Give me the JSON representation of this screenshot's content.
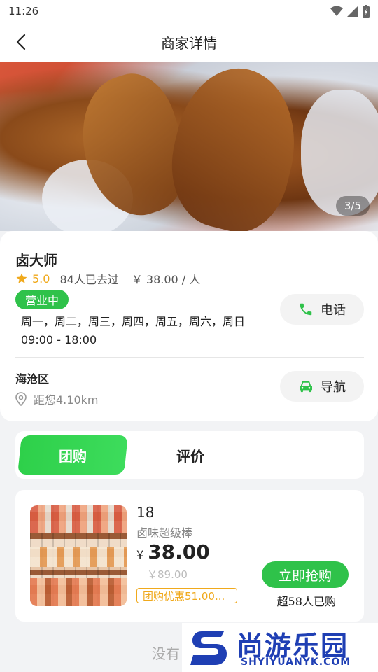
{
  "status_bar": {
    "time": "11:26"
  },
  "nav": {
    "title": "商家详情"
  },
  "hero": {
    "counter": "3/5"
  },
  "shop": {
    "name": "卤大师",
    "rating": "5.0",
    "visitors": "84人已去过",
    "price_per_person": "￥ 38.00 / 人",
    "status": "营业中",
    "days": "周一，周二，周三，周四，周五，周六，周日",
    "hours": "09:00 - 18:00",
    "district": "海沧区",
    "distance": "距您4.10km",
    "call_label": "电话",
    "navigate_label": "导航"
  },
  "tabs": {
    "active": "团购",
    "review": "评价"
  },
  "deal": {
    "quantity": "18",
    "name": "卤味超级棒",
    "currency": "¥",
    "price": "38.00",
    "original_price": "￥89.00",
    "discount": "团购优惠51.00...",
    "buy_label": "立即抢购",
    "sold": "超58人已购"
  },
  "footer": {
    "text": "没有"
  },
  "watermark": {
    "title": "尚游乐园",
    "url": "SHYIYUANYK.COM"
  },
  "colors": {
    "accent": "#2fc24a",
    "star": "#f0a91c",
    "watermark": "#1f3fb4"
  }
}
